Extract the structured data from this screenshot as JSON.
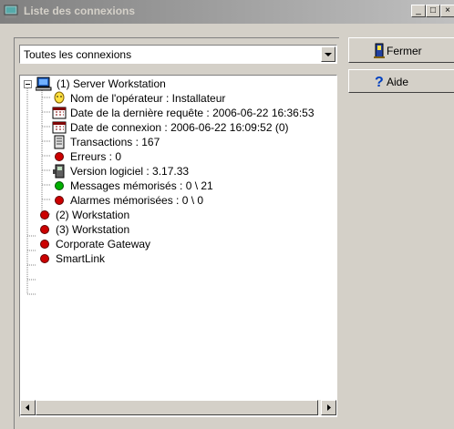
{
  "window": {
    "title": "Liste des connexions",
    "minimize": "_",
    "maximize": "□",
    "close": "×"
  },
  "filter": {
    "selected": "Toutes les connexions"
  },
  "buttons": {
    "close_label": "Fermer",
    "help_label": "Aide"
  },
  "tree": {
    "root": "(1) Server Workstation",
    "details": {
      "operator": "Nom de l'opérateur : Installateur",
      "last_request": "Date de la dernière requête : 2006-06-22 16:36:53",
      "connection_date": "Date de connexion : 2006-06-22 16:09:52  (0)",
      "transactions": "Transactions : 167",
      "errors": "Erreurs : 0",
      "version": "Version logiciel : 3.17.33",
      "messages": "Messages mémorisés : 0 \\ 21",
      "alarms": "Alarmes mémorisées : 0 \\ 0"
    },
    "others": [
      "(2) Workstation",
      "(3) Workstation",
      "Corporate Gateway",
      "SmartLink"
    ]
  },
  "colors": {
    "status_red": "#cc0000",
    "status_green": "#00b000",
    "selection": "#000080"
  }
}
